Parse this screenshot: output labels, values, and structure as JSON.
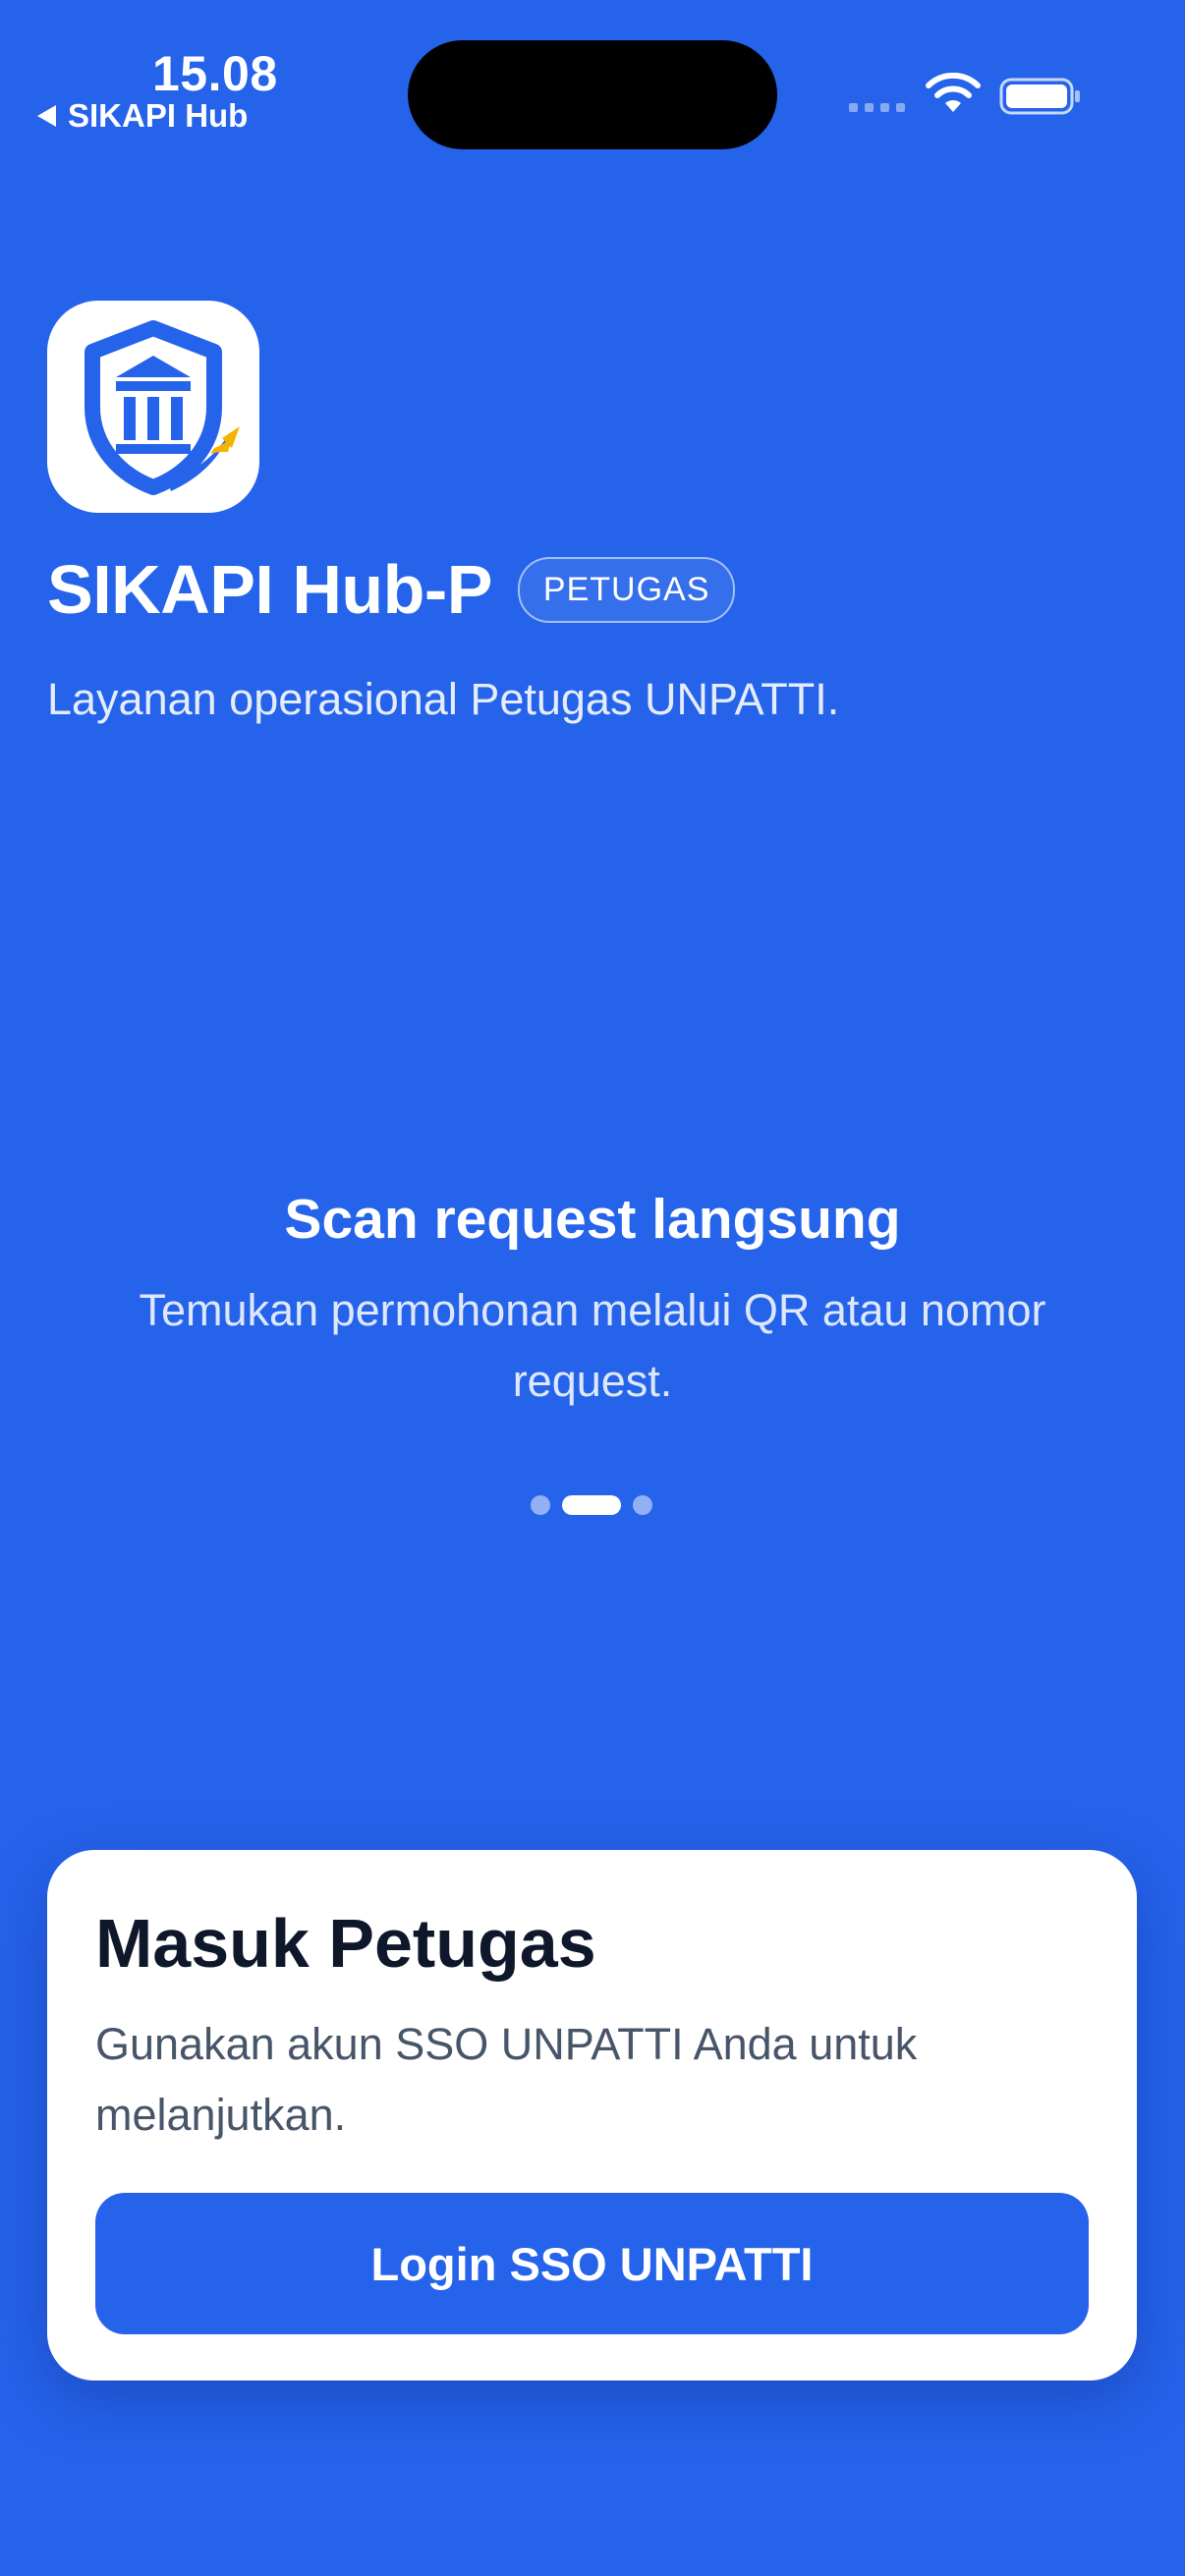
{
  "status_bar": {
    "time": "15.08",
    "back_label": "SIKAPI Hub",
    "icons": [
      "signal-icon",
      "wifi-icon",
      "battery-icon"
    ]
  },
  "header": {
    "logo": "shield-pillar-logo",
    "title": "SIKAPI Hub-P",
    "badge": "PETUGAS",
    "subtitle": "Layanan operasional Petugas UNPATTI."
  },
  "carousel": {
    "slide_title": "Scan request langsung",
    "slide_description": "Temukan permohonan melalui QR atau nomor request.",
    "page_count": 3,
    "active_page": 2
  },
  "login_card": {
    "title": "Masuk Petugas",
    "description": "Gunakan akun SSO UNPATTI Anda untuk melanjutkan.",
    "button_label": "Login SSO UNPATTI"
  },
  "colors": {
    "background": "#2563EB",
    "card": "#FFFFFF",
    "title_text": "#0F172A",
    "body_text": "#475569",
    "logo_accent": "#F5B301"
  }
}
